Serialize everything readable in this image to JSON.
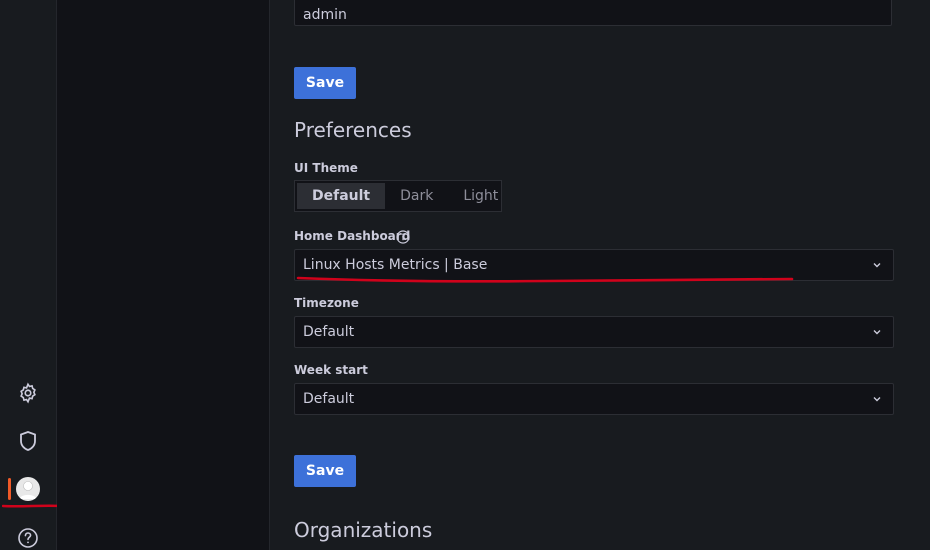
{
  "sidemenu": {
    "icons": [
      "gear-icon",
      "shield-icon",
      "avatar",
      "help-icon"
    ],
    "accent_color": "#f05a28"
  },
  "profile": {
    "login_value": "admin",
    "save_label": "Save"
  },
  "preferences": {
    "title": "Preferences",
    "ui_theme_label": "UI Theme",
    "theme_options": [
      "Default",
      "Dark",
      "Light"
    ],
    "theme_selected": "Default",
    "home_dashboard_label": "Home Dashboard",
    "home_dashboard_value": "Linux Hosts Metrics | Base",
    "timezone_label": "Timezone",
    "timezone_value": "Default",
    "week_start_label": "Week start",
    "week_start_value": "Default",
    "save_label": "Save"
  },
  "organizations": {
    "title": "Organizations"
  },
  "colors": {
    "primary_button": "#3d71d9",
    "annotation": "#d0021b"
  }
}
